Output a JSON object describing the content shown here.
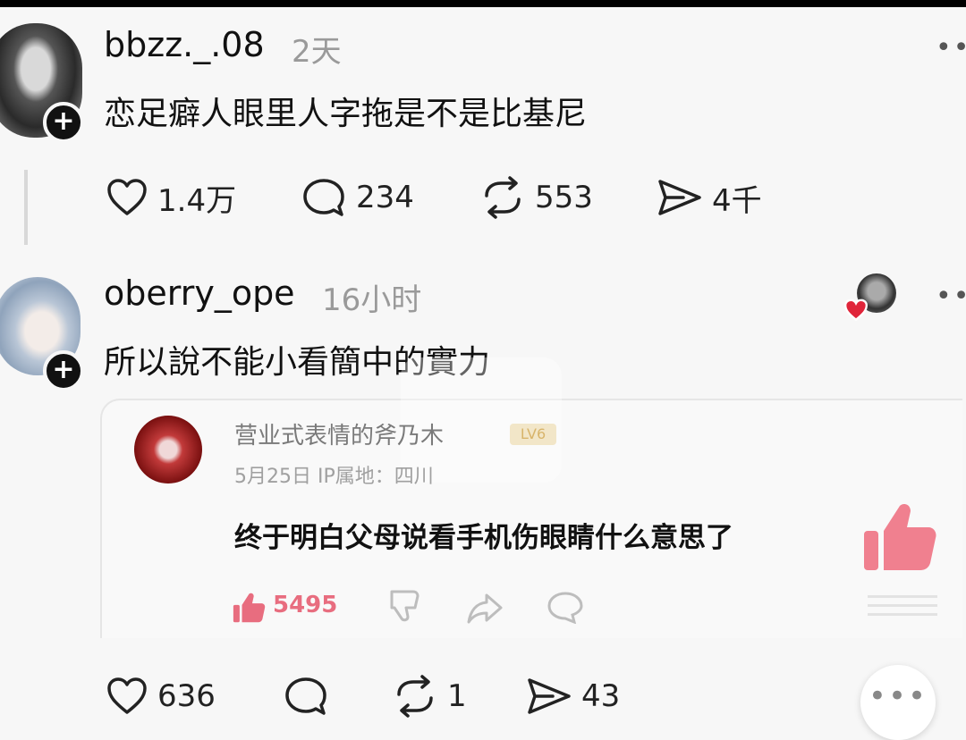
{
  "post1": {
    "username": "bbzz._.08",
    "time": "2天",
    "text": "恋足癖人眼里人字拖是不是比基尼",
    "actions": {
      "likes": "1.4万",
      "comments": "234",
      "reposts": "553",
      "shares": "4千"
    }
  },
  "post2": {
    "username": "oberry_ope",
    "time": "16小时",
    "text": "所以說不能小看簡中的實力",
    "embedded": {
      "name": "营业式表情的斧乃木",
      "tag": "LV6",
      "meta": "5月25日  IP属地：四川",
      "text": "终于明白父母说看手机伤眼睛什么意思了",
      "like_count": "5495"
    },
    "actions": {
      "likes": "636",
      "comments": "",
      "reposts": "1",
      "shares": "43"
    }
  },
  "icons": {
    "more": "more-dots-icon",
    "heart": "heart-icon",
    "comment": "comment-icon",
    "repost": "repost-icon",
    "share": "share-icon"
  },
  "colors": {
    "accent_pink": "#e86d7f",
    "heart_red": "#e0253a"
  }
}
